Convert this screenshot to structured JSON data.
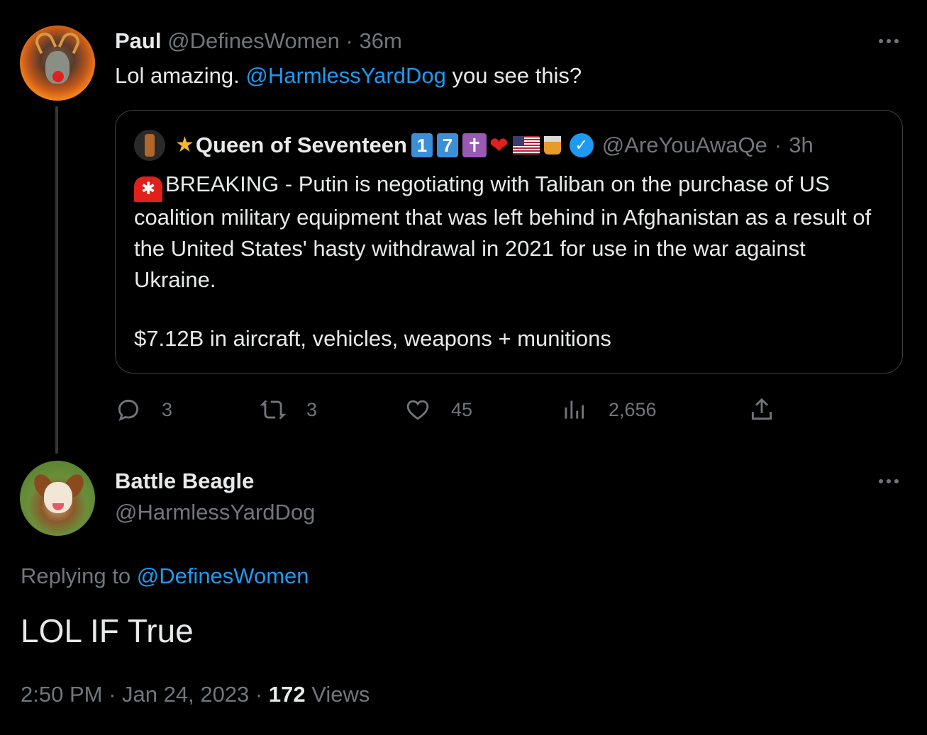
{
  "parent_tweet": {
    "author_name": "Paul",
    "author_handle": "@DefinesWomen",
    "separator": "·",
    "time": "36m",
    "text_before": "Lol amazing.",
    "mention": "@HarmlessYardDog",
    "text_after": "you see this?",
    "actions": {
      "replies": "3",
      "retweets": "3",
      "likes": "45",
      "views": "2,656"
    }
  },
  "quoted_tweet": {
    "author_name": "Queen of Seventeen",
    "badge_1": "1",
    "badge_7": "7",
    "cross": "✝",
    "heart": "❤",
    "author_handle": "@AreYouAwaQe",
    "separator": "·",
    "time": "3h",
    "body": "BREAKING - Putin is negotiating with Taliban on the purchase of US coalition military equipment that was left behind in Afghanistan as a result of the United States' hasty withdrawal in 2021 for use in the war against Ukraine.",
    "amount_line": "$7.12B in aircraft, vehicles, weapons + munitions"
  },
  "main_tweet": {
    "author_name": "Battle Beagle",
    "author_handle": "@HarmlessYardDog",
    "replying_label": "Replying to",
    "replying_handle": "@DefinesWomen",
    "text": "LOL IF True",
    "time": "2:50 PM",
    "separator": "·",
    "date": "Jan 24, 2023",
    "separator2": "·",
    "views_count": "172",
    "views_label": "Views"
  },
  "colors": {
    "background": "#000000",
    "text": "#e7e9ea",
    "muted": "#71767b",
    "link": "#1d9bf0",
    "border": "#3e4144"
  },
  "icons": [
    "more-icon",
    "reply-icon",
    "retweet-icon",
    "like-icon",
    "views-icon",
    "share-icon",
    "verified-icon"
  ]
}
